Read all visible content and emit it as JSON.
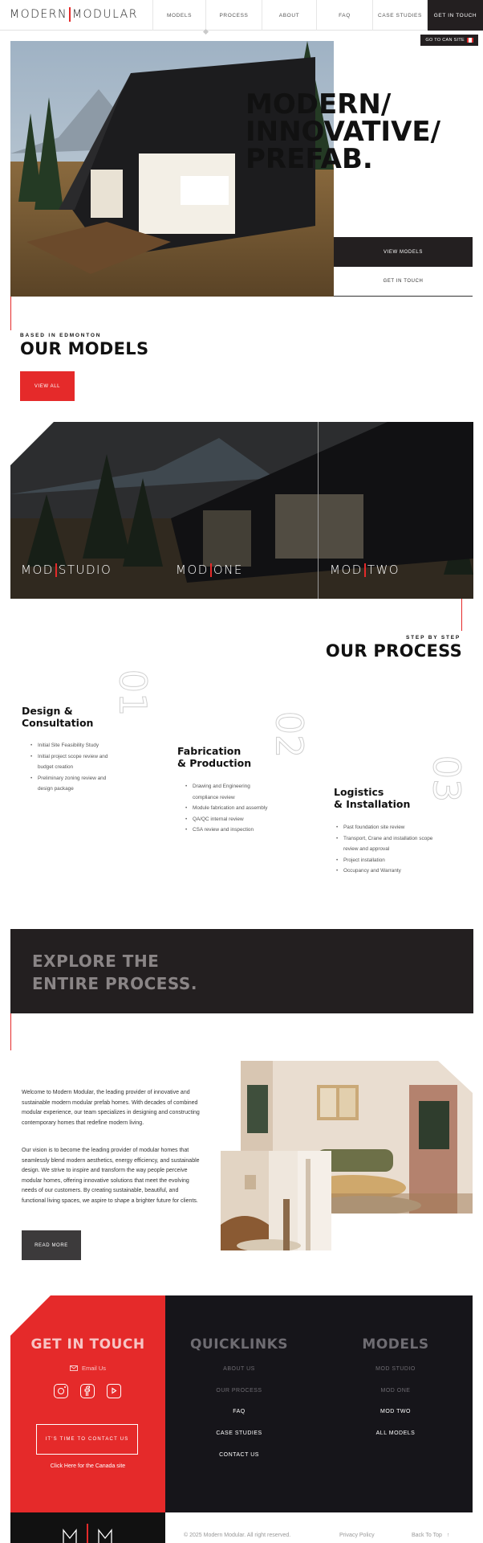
{
  "nav": {
    "logo_left": "MODERN",
    "logo_right": "MODULAR",
    "items": [
      "MODELS",
      "PROCESS",
      "ABOUT",
      "FAQ",
      "CASE STUDIES"
    ],
    "cta": "GET IN TOUCH",
    "sub_cta": "GO TO CAN SITE"
  },
  "hero": {
    "title_lines": [
      "MODERN/",
      "INNOVATIVE/",
      "PREFAB."
    ],
    "btn_primary": "VIEW MODELS",
    "btn_secondary": "GET IN TOUCH"
  },
  "models": {
    "eyebrow": "BASED IN EDMONTON",
    "title": "OUR MODELS",
    "btn": "VIEW ALL",
    "items": [
      {
        "a": "MOD",
        "b": "STUDIO"
      },
      {
        "a": "MOD",
        "b": "ONE"
      },
      {
        "a": "MOD",
        "b": "TWO"
      }
    ]
  },
  "process": {
    "eyebrow": "STEP BY STEP",
    "title": "OUR PROCESS",
    "steps": [
      {
        "num": "01",
        "title1": "Design &",
        "title2": "Consultation",
        "items": [
          "Initial Site Feasibility Study",
          "Initial project scope review and budget creation",
          "Preliminary zoning review and design package"
        ]
      },
      {
        "num": "02",
        "title1": "Fabrication",
        "title2": "& Production",
        "items": [
          "Drawing and Engineering compliance review",
          "Module fabrication and assembly",
          "QA/QC internal review",
          "CSA review and inspection"
        ]
      },
      {
        "num": "03",
        "title1": "Logistics",
        "title2": "& Installation",
        "items": [
          "Past foundation site review",
          "Transport, Crane and installation scope review and approval",
          "Project installation",
          "Occupancy and Warranty"
        ]
      }
    ]
  },
  "explore": {
    "line1": "EXPLORE THE",
    "line2": "ENTIRE PROCESS."
  },
  "about": {
    "p1": "Welcome to Modern Modular, the leading provider of innovative and sustainable modern modular prefab homes. With decades of combined modular experience, our team specializes in designing and constructing contemporary homes that redefine modern living.",
    "p2": "Our vision is to become the leading provider of modular homes that seamlessly blend modern aesthetics, energy efficiency, and sustainable design. We strive to inspire and transform the way people perceive modular homes, offering innovative solutions that meet the evolving needs of our customers. By creating sustainable, beautiful, and functional living spaces, we aspire to shape a brighter future for clients.",
    "btn": "READ MORE"
  },
  "footer": {
    "touch_title": "GET IN TOUCH",
    "email": "Email Us",
    "contact_btn": "IT'S TIME TO CONTACT US",
    "canada_link": "Click Here for the Canada site",
    "quicklinks_title": "QUICKLINKS",
    "quicklinks": [
      "ABOUT US",
      "OUR PROCESS",
      "FAQ",
      "CASE STUDIES",
      "CONTACT US"
    ],
    "models_title": "MODELS",
    "model_links": [
      "MOD STUDIO",
      "MOD ONE",
      "MOD TWO",
      "ALL MODELS"
    ],
    "copyright": "© 2025 Modern Modular. All right reserved.",
    "privacy": "Privacy Policy",
    "back_top": "Back To Top"
  },
  "colors": {
    "accent": "#e52a2a",
    "dark": "#231f20",
    "footer_dark": "#16151a"
  }
}
